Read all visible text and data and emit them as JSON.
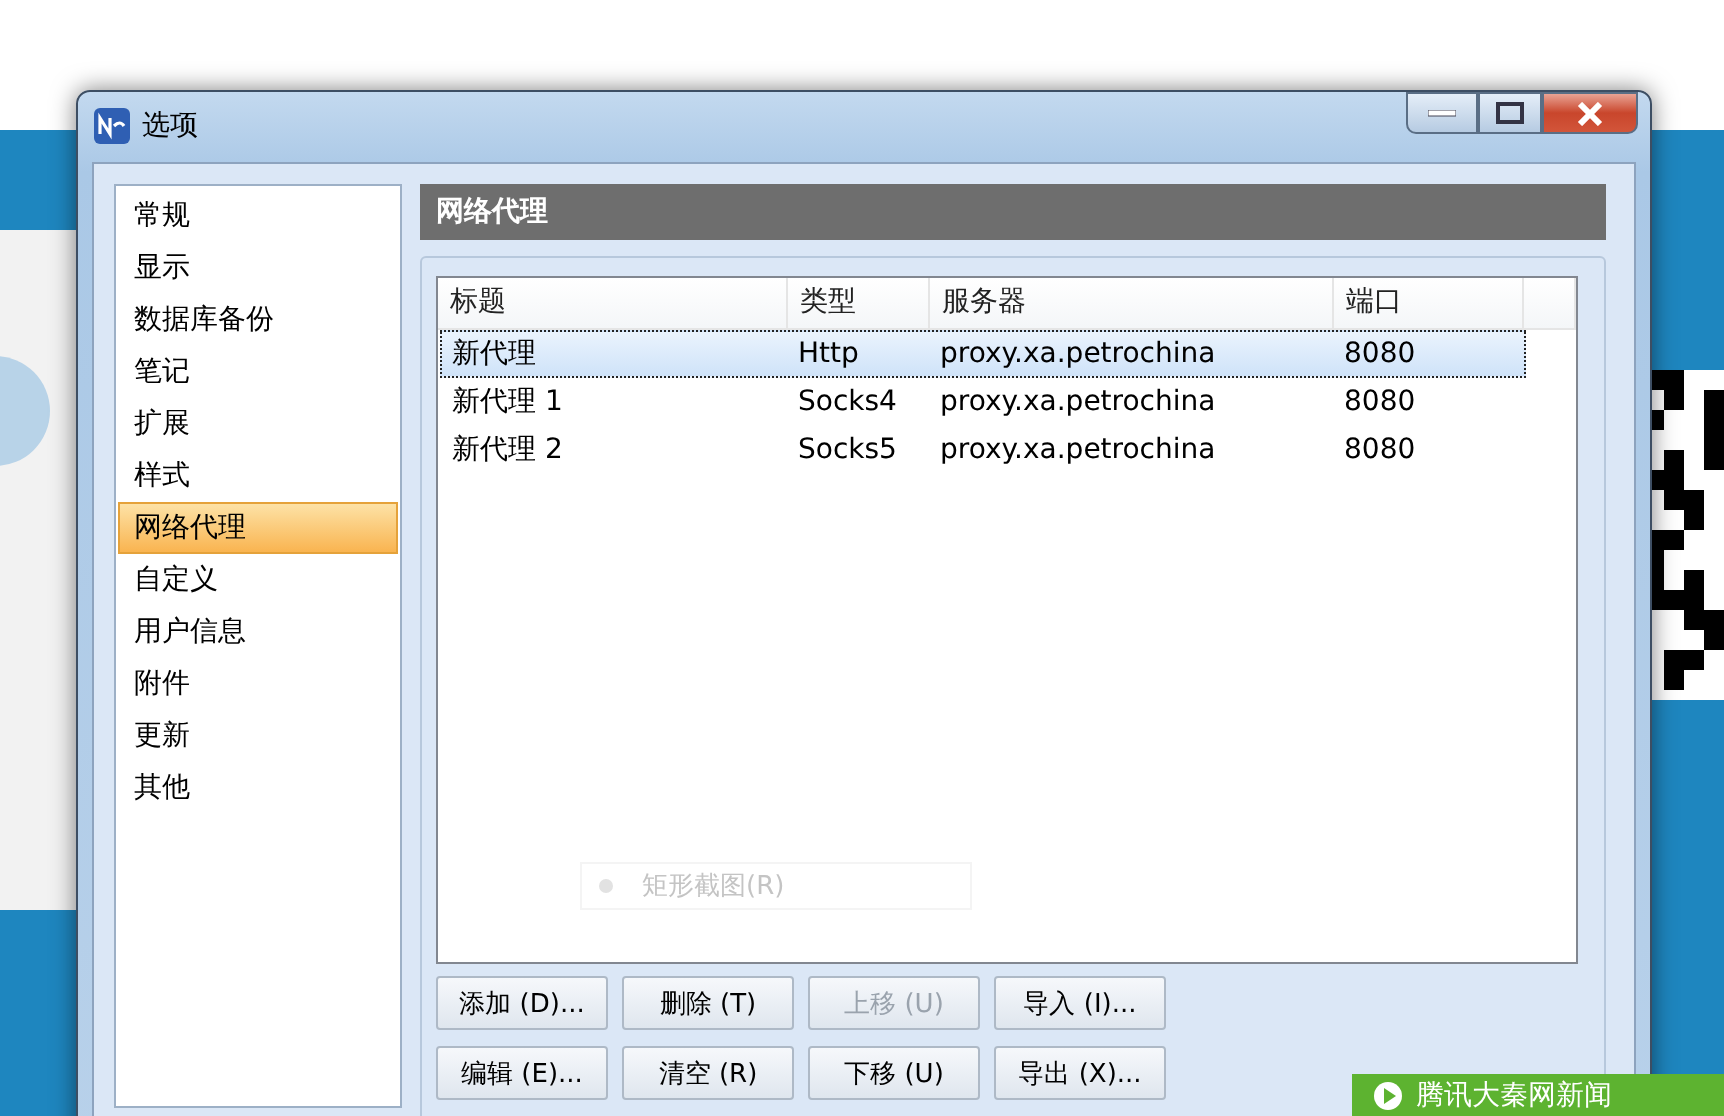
{
  "window": {
    "title": "选项"
  },
  "sidebar": {
    "items": [
      {
        "label": "常规",
        "selected": false
      },
      {
        "label": "显示",
        "selected": false
      },
      {
        "label": "数据库备份",
        "selected": false
      },
      {
        "label": "笔记",
        "selected": false
      },
      {
        "label": "扩展",
        "selected": false
      },
      {
        "label": "样式",
        "selected": false
      },
      {
        "label": "网络代理",
        "selected": true
      },
      {
        "label": "自定义",
        "selected": false
      },
      {
        "label": "用户信息",
        "selected": false
      },
      {
        "label": "附件",
        "selected": false
      },
      {
        "label": "更新",
        "selected": false
      },
      {
        "label": "其他",
        "selected": false
      }
    ]
  },
  "panel": {
    "title": "网络代理"
  },
  "table": {
    "columns": [
      "标题",
      "类型",
      "服务器",
      "端口"
    ],
    "rows": [
      {
        "cells": [
          "新代理",
          "Http",
          "proxy.xa.petrochina",
          "8080"
        ],
        "selected": true
      },
      {
        "cells": [
          "新代理 1",
          "Socks4",
          "proxy.xa.petrochina",
          "8080"
        ],
        "selected": false
      },
      {
        "cells": [
          "新代理 2",
          "Socks5",
          "proxy.xa.petrochina",
          "8080"
        ],
        "selected": false
      }
    ]
  },
  "ghost_menu_item": "矩形截图(R)",
  "buttons": [
    {
      "label": "添加 (D)...",
      "disabled": false
    },
    {
      "label": "删除 (T)",
      "disabled": false
    },
    {
      "label": "上移 (U)",
      "disabled": true
    },
    {
      "label": "导入 (I)...",
      "disabled": false
    },
    {
      "label": "编辑 (E)...",
      "disabled": false
    },
    {
      "label": "清空 (R)",
      "disabled": false
    },
    {
      "label": "下移 (U)",
      "disabled": false
    },
    {
      "label": "导出 (X)...",
      "disabled": false
    }
  ],
  "news_bar": {
    "text": "腾讯大秦网新闻"
  }
}
